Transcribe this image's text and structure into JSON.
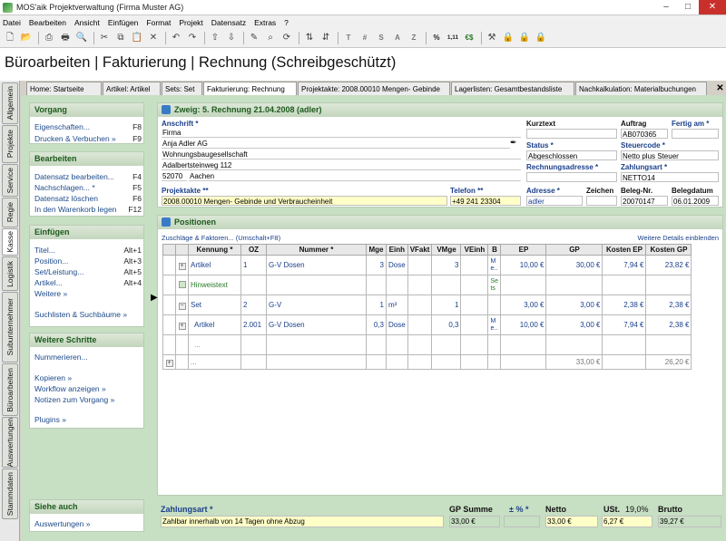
{
  "window": {
    "title": "MOS'aik Projektverwaltung (Firma Muster AG)"
  },
  "menu": [
    "Datei",
    "Bearbeiten",
    "Ansicht",
    "Einfügen",
    "Format",
    "Projekt",
    "Datensatz",
    "Extras",
    "?"
  ],
  "toolbar_text": [
    "T",
    "#",
    "S",
    "A",
    "Z",
    "%",
    "1,11",
    "€$"
  ],
  "headline": "Büroarbeiten | Fakturierung | Rechnung (Schreibgeschützt)",
  "vtabs": [
    "Allgemein",
    "Projekte",
    "Service",
    "Regie",
    "Kasse",
    "Logistik",
    "Subunternehmer",
    "Büroarbeiten",
    "Auswertungen",
    "Stammdaten"
  ],
  "tabs": [
    "Home: Startseite",
    "Artikel: Artikel",
    "Sets: Set",
    "Fakturierung: Rechnung",
    "Projektakte: 2008.00010 Mengen- Gebinde",
    "Lagerlisten: Gesamtbestandsliste",
    "Nachkalkulation: Materialbuchungen"
  ],
  "sidebar": {
    "vorgang": {
      "title": "Vorgang",
      "items": [
        {
          "label": "Eigenschaften...",
          "key": "F8"
        },
        {
          "label": "Drucken & Verbuchen »",
          "key": "F9"
        }
      ]
    },
    "bearbeiten": {
      "title": "Bearbeiten",
      "items": [
        {
          "label": "Datensatz bearbeiten...",
          "key": "F4"
        },
        {
          "label": "Nachschlagen... *",
          "key": "F5"
        },
        {
          "label": "Datensatz löschen",
          "key": "F6"
        },
        {
          "label": "In den Warenkorb legen",
          "key": "F12"
        }
      ]
    },
    "einfuegen": {
      "title": "Einfügen",
      "items": [
        {
          "label": "Titel...",
          "key": "Alt+1"
        },
        {
          "label": "Position...",
          "key": "Alt+3"
        },
        {
          "label": "Set/Leistung...",
          "key": "Alt+5"
        },
        {
          "label": "Artikel...",
          "key": "Alt+4"
        },
        {
          "label": "Weitere »",
          "key": ""
        },
        {
          "label": "Suchlisten & Suchbäume »",
          "key": ""
        }
      ]
    },
    "weitere": {
      "title": "Weitere Schritte",
      "items": [
        {
          "label": "Nummerieren...",
          "key": ""
        },
        {
          "label": "Kopieren »",
          "key": ""
        },
        {
          "label": "Workflow anzeigen »",
          "key": ""
        },
        {
          "label": "Notizen zum Vorgang »",
          "key": ""
        },
        {
          "label": "Plugins »",
          "key": ""
        }
      ]
    },
    "siehe": {
      "title": "Siehe auch",
      "items": [
        {
          "label": "Auswertungen »",
          "key": ""
        }
      ]
    }
  },
  "zweig": {
    "title": "Zweig: 5. Rechnung 21.04.2008 (adler)",
    "anschrift_label": "Anschrift *",
    "anschrift": [
      "Firma",
      "Anja Adler AG",
      "Wohnungsbaugesellschaft",
      "Adalbertsteinweg 112"
    ],
    "plz": "52070",
    "ort": "Aachen",
    "kurztext_label": "Kurztext",
    "status_label": "Status *",
    "status": "Abgeschlossen",
    "rechadr_label": "Rechnungsadresse *",
    "auftrag_label": "Auftrag",
    "auftrag": "AB070365",
    "fertig_label": "Fertig am *",
    "steuer_label": "Steuercode *",
    "steuer": "Netto plus Steuer",
    "zahlungsart_label": "Zahlungsart *",
    "zahlungsart": "NETTO14",
    "projektakte_label": "Projektakte **",
    "projektakte": "2008.00010 Mengen- Gebinde und Verbraucheinheit",
    "telefon_label": "Telefon **",
    "telefon": "+49 241 23304",
    "adresse_label": "Adresse *",
    "adresse": "adler",
    "zeichen_label": "Zeichen",
    "belegnr_label": "Beleg-Nr.",
    "belegnr": "20070147",
    "belegdatum_label": "Belegdatum",
    "belegdatum": "06.01.2009"
  },
  "positionen": {
    "title": "Positionen",
    "link_left": "Zuschläge & Faktoren... (Umschalt+F8)",
    "link_right": "Weitere Details einblenden",
    "headers": [
      "Kennung *",
      "OZ",
      "Nummer *",
      "Mge",
      "Einh",
      "VFakt",
      "VMge",
      "VEinh",
      "B",
      "EP",
      "GP",
      "Kosten EP",
      "Kosten GP"
    ],
    "rows": [
      {
        "kennung": "Artikel",
        "oz": "1",
        "nummer": "G-V Dosen",
        "mge": "3",
        "einh": "Dose",
        "vfakt": "",
        "vmge": "3",
        "veinh": "",
        "b": "M e..",
        "ep": "10,00 €",
        "gp": "30,00 €",
        "kep": "7,94 €",
        "kgp": "23,82 €"
      },
      {
        "kennung": "Hinweistext",
        "oz": "",
        "nummer": "",
        "mge": "",
        "einh": "",
        "vfakt": "",
        "vmge": "",
        "veinh": "",
        "b": "Se ts",
        "ep": "",
        "gp": "",
        "kep": "",
        "kgp": ""
      },
      {
        "kennung": "Set",
        "oz": "2",
        "nummer": "G-V",
        "mge": "1",
        "einh": "m³",
        "vfakt": "",
        "vmge": "1",
        "veinh": "",
        "b": "",
        "ep": "3,00 €",
        "gp": "3,00 €",
        "kep": "2,38 €",
        "kgp": "2,38 €"
      },
      {
        "kennung": "Artikel",
        "oz": "2.001",
        "nummer": "G-V Dosen",
        "mge": "0,3",
        "einh": "Dose",
        "vfakt": "",
        "vmge": "0,3",
        "veinh": "",
        "b": "M e..",
        "ep": "10,00 €",
        "gp": "3,00 €",
        "kep": "7,94 €",
        "kgp": "2,38 €"
      },
      {
        "kennung": "...",
        "oz": "",
        "nummer": "",
        "mge": "",
        "einh": "",
        "vfakt": "",
        "vmge": "",
        "veinh": "",
        "b": "",
        "ep": "",
        "gp": "",
        "kep": "",
        "kgp": ""
      }
    ],
    "sum": {
      "kennung": "...",
      "gp": "33,00 €",
      "kgp": "26,20 €"
    }
  },
  "footer": {
    "zahlungsart_label": "Zahlungsart *",
    "zahlungsart_value": "Zahlbar innerhalb von 14 Tagen ohne Abzug",
    "gpsumme_label": "GP Summe",
    "gpsumme": "33,00 €",
    "pct_label": "± % *",
    "netto_label": "Netto",
    "netto": "33,00 €",
    "ust_label": "USt.",
    "ust_pct": "19,0%",
    "ust": "6,27 €",
    "brutto_label": "Brutto",
    "brutto": "39,27 €"
  }
}
